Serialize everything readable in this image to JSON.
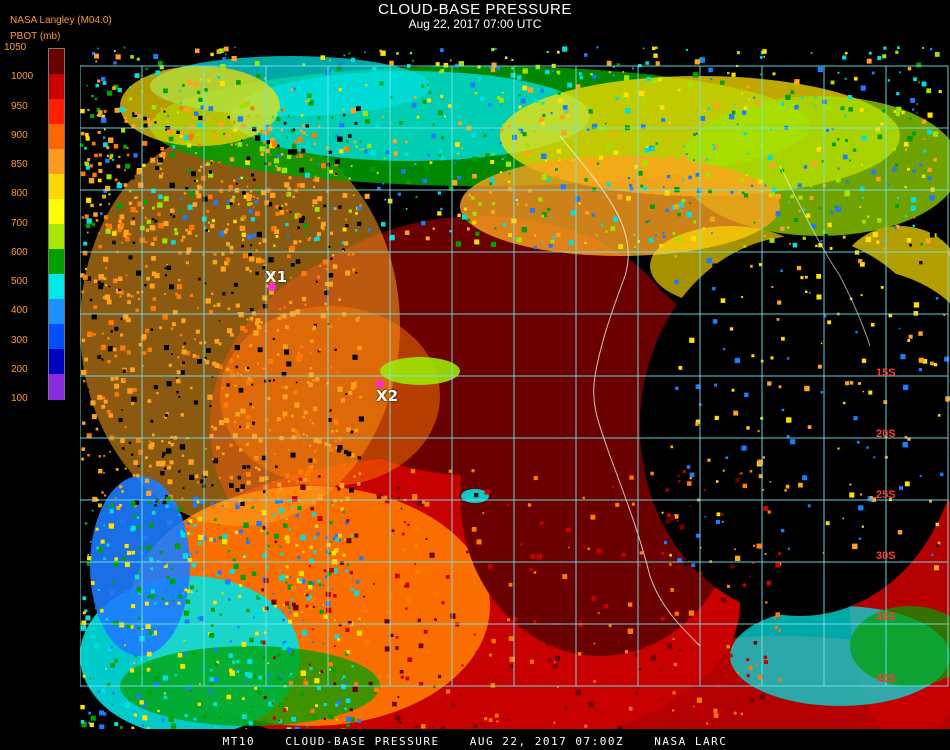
{
  "header": {
    "title": "CLOUD-BASE PRESSURE",
    "subtitle": "Aug 22, 2017 07:00 UTC",
    "producer": "NASA Langley (M04.0)",
    "parameter": "PBOT (mb)"
  },
  "legend": {
    "labels": [
      "1050",
      "1000",
      "950",
      "900",
      "850",
      "800",
      "700",
      "600",
      "500",
      "400",
      "300",
      "200",
      "100"
    ],
    "colors": [
      "#6a0000",
      "#c80000",
      "#ff1e00",
      "#ff6400",
      "#ff9a1e",
      "#ffd700",
      "#ffff00",
      "#a8e800",
      "#00a000",
      "#00e8e8",
      "#1e90ff",
      "#0050ff",
      "#0000c0",
      "#8a2be2"
    ]
  },
  "map": {
    "markers": [
      {
        "label": "X1",
        "color": "#ff2bd6"
      },
      {
        "label": "X2",
        "color": "#ff2bd6"
      }
    ],
    "lat_labels": [
      "15S",
      "20S",
      "25S",
      "30S",
      "35S",
      "40S"
    ],
    "palette": {
      "sea_deep": "#6a0000",
      "sea_red": "#c80000",
      "orange": "#ff7a00",
      "amber": "#ffa21e",
      "yellow": "#ffe000",
      "lime": "#9ee600",
      "green": "#00a000",
      "cyan": "#00e0e0",
      "blue": "#1e7bff",
      "grid": "#6ee6f0"
    }
  },
  "footer": {
    "satellite": "MT10",
    "product": "CLOUD-BASE PRESSURE",
    "datetime": "AUG 22, 2017 07:00Z",
    "source": "NASA LARC"
  }
}
